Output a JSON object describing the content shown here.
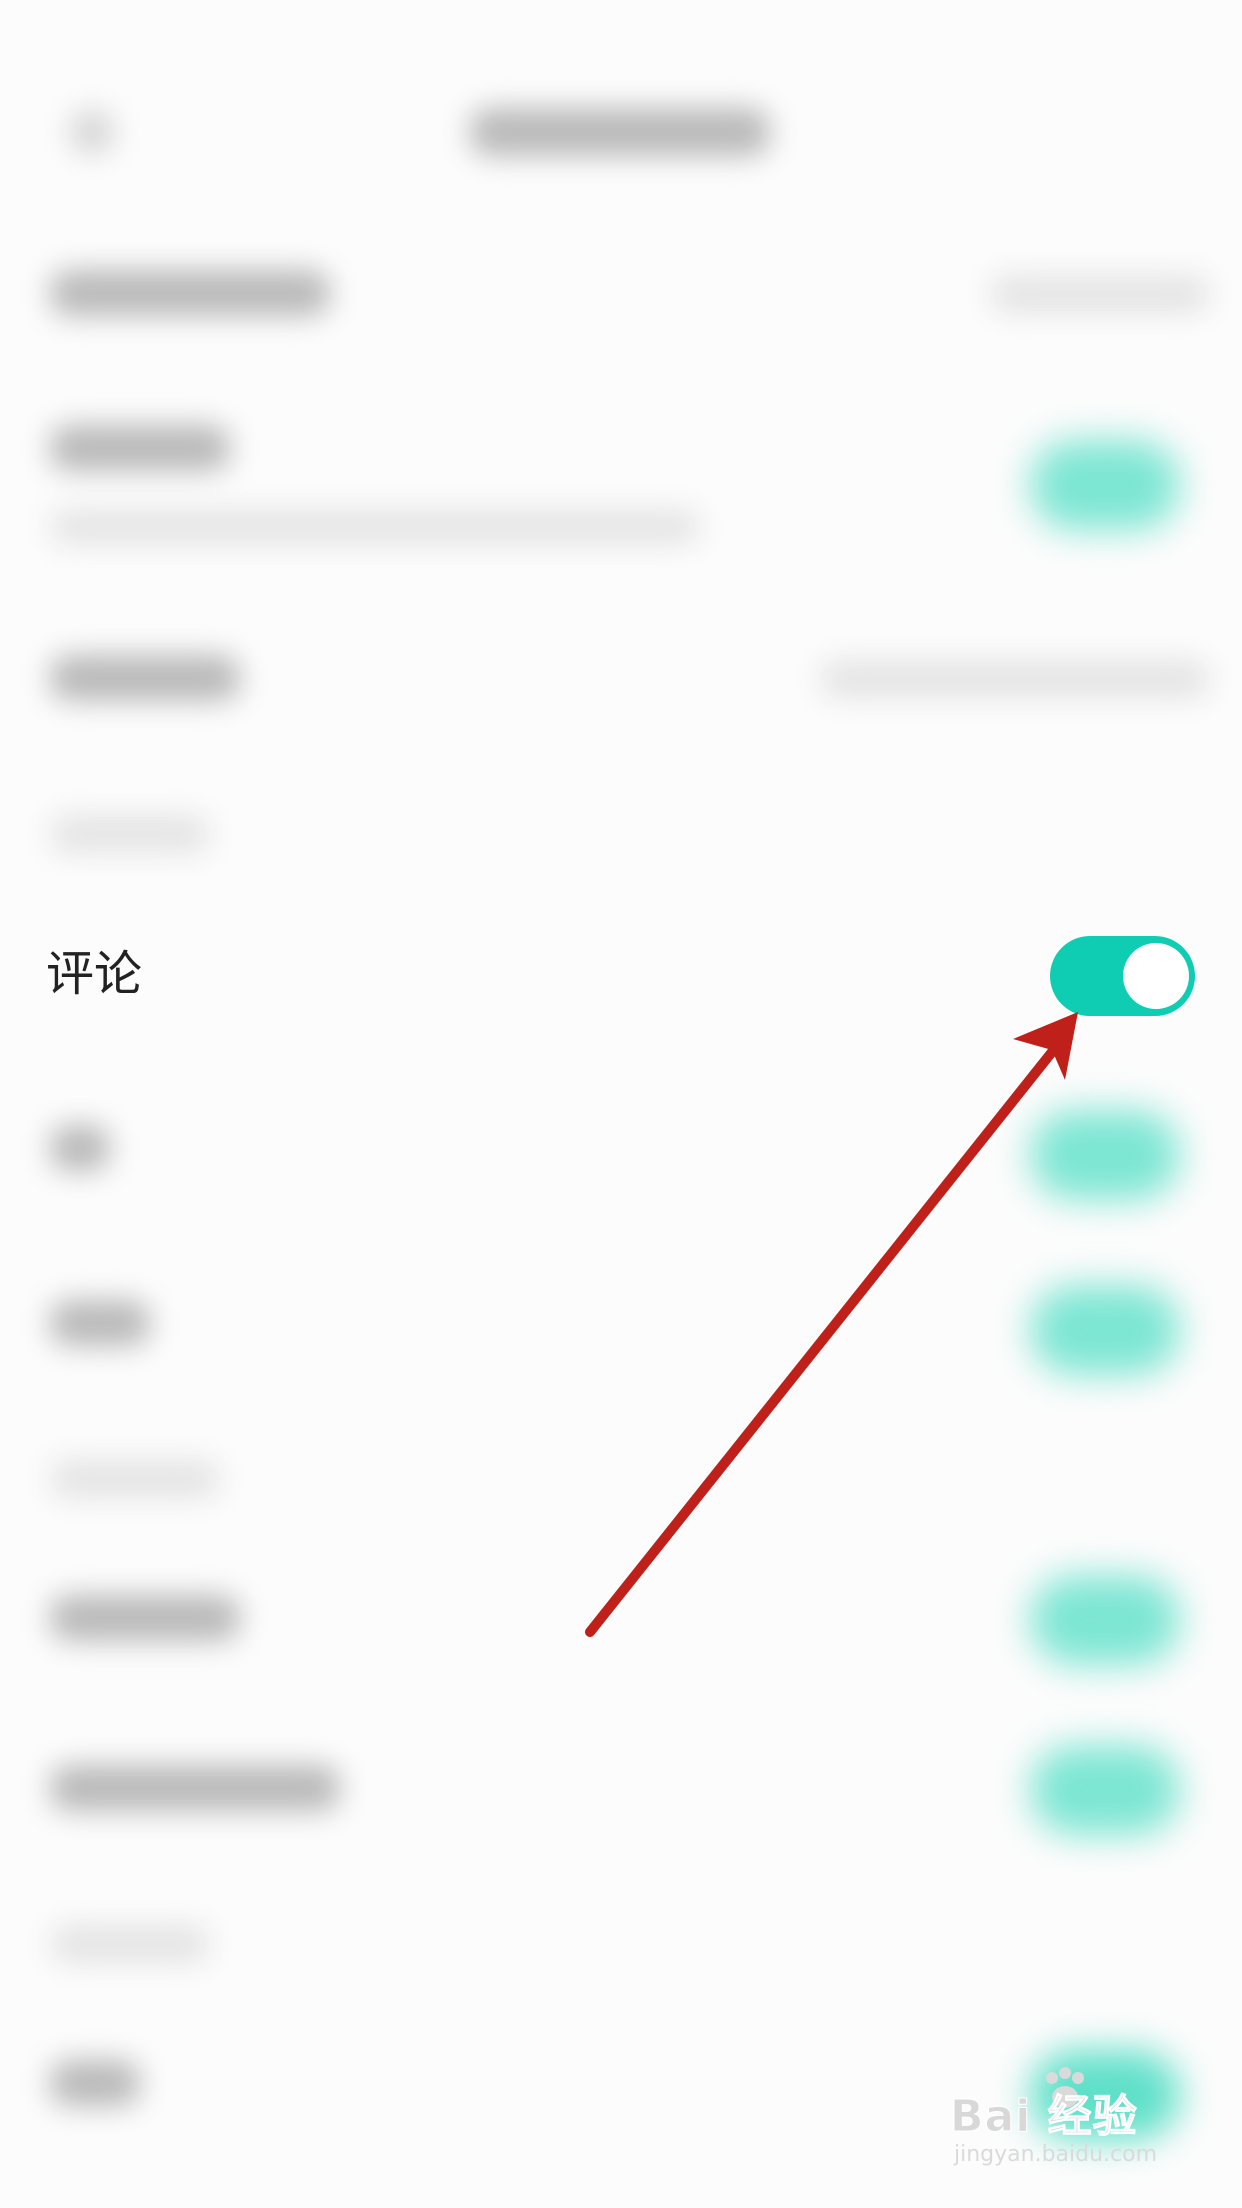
{
  "comment_row": {
    "label": "评论",
    "toggle_on": true
  },
  "colors": {
    "accent": "#0fcdb2",
    "annotation_arrow": "#c0201a",
    "text": "#222222",
    "background": "#fcfcfc"
  },
  "watermark": {
    "main": "Bai 经验",
    "sub": "jingyan.baidu.com"
  }
}
